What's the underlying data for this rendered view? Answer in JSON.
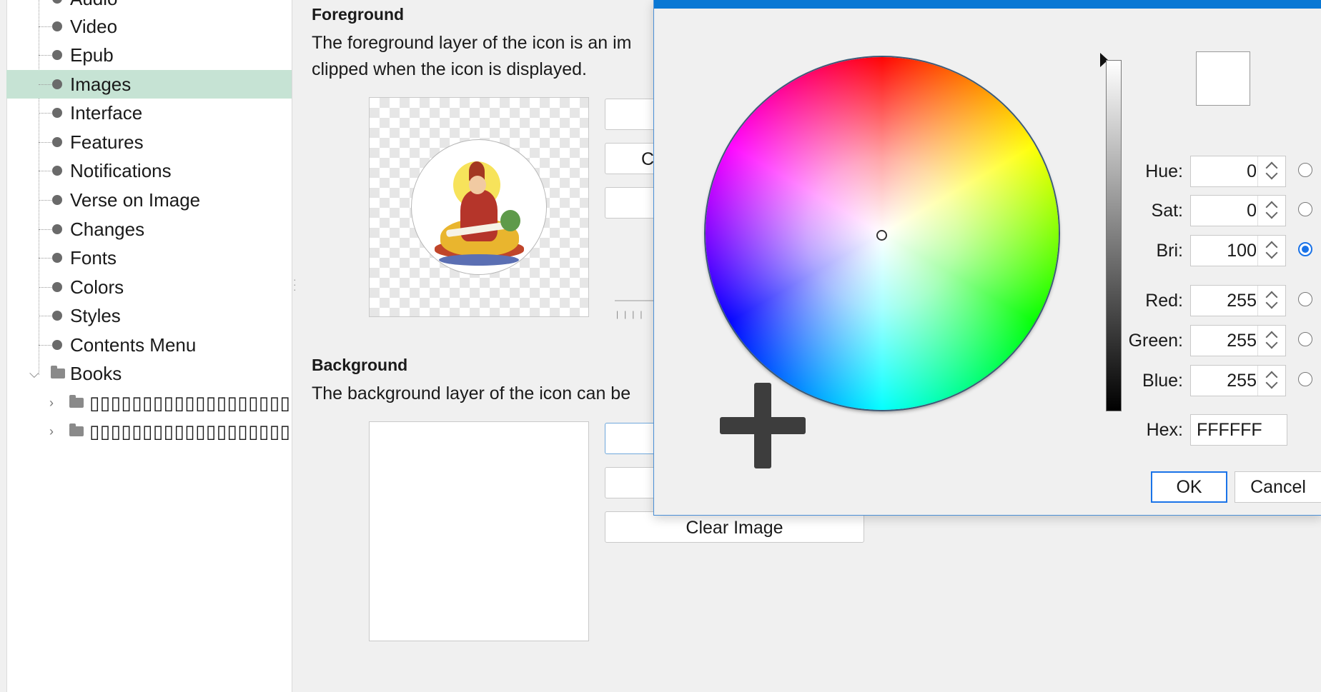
{
  "sidebar": {
    "items": [
      {
        "label": "Audio"
      },
      {
        "label": "Video"
      },
      {
        "label": "Epub"
      },
      {
        "label": "Images"
      },
      {
        "label": "Interface"
      },
      {
        "label": "Features"
      },
      {
        "label": "Notifications"
      },
      {
        "label": "Verse on Image"
      },
      {
        "label": "Changes"
      },
      {
        "label": "Fonts"
      },
      {
        "label": "Colors"
      },
      {
        "label": "Styles"
      },
      {
        "label": "Contents Menu"
      },
      {
        "label": "Books"
      },
      {
        "label": "▯▯▯▯▯▯▯▯▯▯▯▯▯▯▯▯▯▯▯"
      },
      {
        "label": "▯▯▯▯▯▯▯▯▯▯▯▯▯▯▯▯▯▯▯"
      }
    ],
    "selected": "Images"
  },
  "main": {
    "foreground": {
      "title": "Foreground",
      "desc_line1": "The foreground layer of the icon is an im",
      "desc_line2": "clipped when the icon is displayed.",
      "btn2_partial": "C"
    },
    "background": {
      "title": "Background",
      "desc_line1": "The background layer of the icon can be",
      "clear_button": "Clear Image"
    }
  },
  "color_dialog": {
    "swatch_color": "#FFFFFF",
    "hue": {
      "label": "Hue:",
      "value": "0"
    },
    "sat": {
      "label": "Sat:",
      "value": "0"
    },
    "bri": {
      "label": "Bri:",
      "value": "100"
    },
    "red": {
      "label": "Red:",
      "value": "255"
    },
    "green": {
      "label": "Green:",
      "value": "255"
    },
    "blue": {
      "label": "Blue:",
      "value": "255"
    },
    "hex": {
      "label": "Hex:",
      "value": "FFFFFF"
    },
    "selected_mode": "Bri",
    "ok_label": "OK",
    "cancel_label": "Cancel",
    "accent_color": "#0a78d4"
  }
}
